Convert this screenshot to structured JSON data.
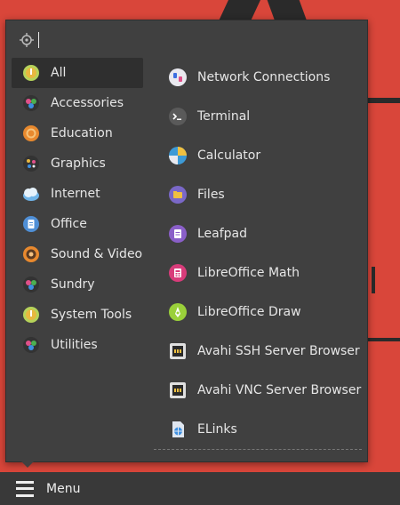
{
  "search": {
    "placeholder": ""
  },
  "categories": [
    {
      "label": "All",
      "icon": "all-icon",
      "selected": true
    },
    {
      "label": "Accessories",
      "icon": "accessories-icon"
    },
    {
      "label": "Education",
      "icon": "education-icon"
    },
    {
      "label": "Graphics",
      "icon": "graphics-icon"
    },
    {
      "label": "Internet",
      "icon": "internet-icon"
    },
    {
      "label": "Office",
      "icon": "office-icon"
    },
    {
      "label": "Sound & Video",
      "icon": "sound-video-icon"
    },
    {
      "label": "Sundry",
      "icon": "sundry-icon"
    },
    {
      "label": "System Tools",
      "icon": "system-tools-icon"
    },
    {
      "label": "Utilities",
      "icon": "utilities-icon"
    }
  ],
  "apps": [
    {
      "label": "Network Connections",
      "icon": "network-connections-icon"
    },
    {
      "label": "Terminal",
      "icon": "terminal-icon"
    },
    {
      "label": "Calculator",
      "icon": "calculator-icon"
    },
    {
      "label": "Files",
      "icon": "files-icon"
    },
    {
      "label": "Leafpad",
      "icon": "leafpad-icon"
    },
    {
      "label": "LibreOffice Math",
      "icon": "libreoffice-math-icon"
    },
    {
      "label": "LibreOffice Draw",
      "icon": "libreoffice-draw-icon"
    },
    {
      "label": "Avahi SSH Server Browser",
      "icon": "avahi-ssh-icon"
    },
    {
      "label": "Avahi VNC Server Browser",
      "icon": "avahi-vnc-icon"
    },
    {
      "label": "ELinks",
      "icon": "elinks-icon"
    }
  ],
  "panel": {
    "menu_label": "Menu",
    "menu_icon": "hamburger-icon"
  },
  "colors": {
    "popup_bg": "#404040",
    "selected_bg": "#2f2f2f",
    "desktop_bg": "#d9463a",
    "text": "#e6e6e6"
  }
}
